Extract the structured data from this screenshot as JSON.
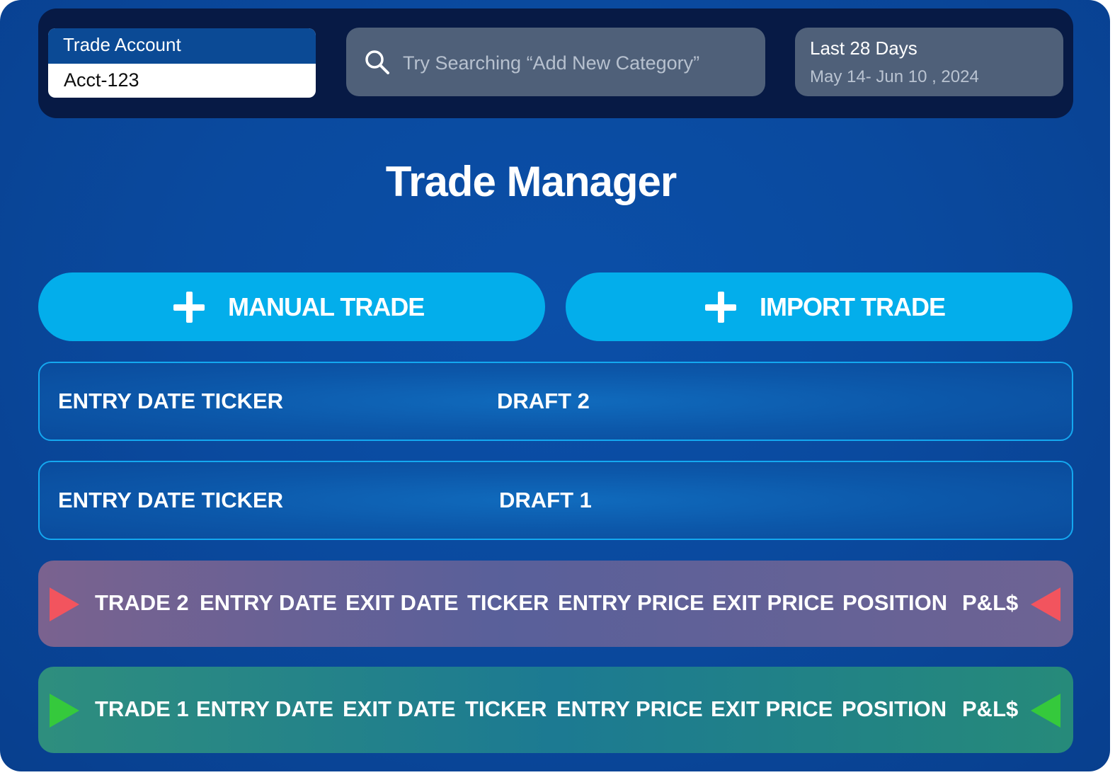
{
  "header": {
    "account": {
      "label": "Trade Account",
      "value": "Acct-123"
    },
    "search": {
      "placeholder": "Try Searching “Add New Category”",
      "icon": "search-icon"
    },
    "date_range": {
      "title": "Last 28 Days",
      "range": "May 14- Jun 10 , 2024"
    }
  },
  "page_title": "Trade Manager",
  "actions": {
    "manual_trade": "MANUAL TRADE",
    "import_trade": "IMPORT TRADE",
    "icon": "plus-icon",
    "color": "#03aeeb"
  },
  "drafts": [
    {
      "left": "ENTRY DATE TICKER",
      "right": "DRAFT 2"
    },
    {
      "left": "ENTRY DATE TICKER",
      "right": "DRAFT 1"
    }
  ],
  "trades": [
    {
      "name": "TRADE 2",
      "status_color": "#f2545e",
      "columns": [
        "ENTRY DATE",
        "EXIT DATE",
        "TICKER",
        "ENTRY PRICE",
        "EXIT PRICE",
        "POSITION",
        "P&L$"
      ]
    },
    {
      "name": "TRADE 1",
      "status_color": "#35c93c",
      "columns": [
        "ENTRY DATE",
        "EXIT DATE",
        "TICKER",
        "ENTRY PRICE",
        "EXIT PRICE",
        "POSITION",
        "P&L$"
      ]
    }
  ]
}
